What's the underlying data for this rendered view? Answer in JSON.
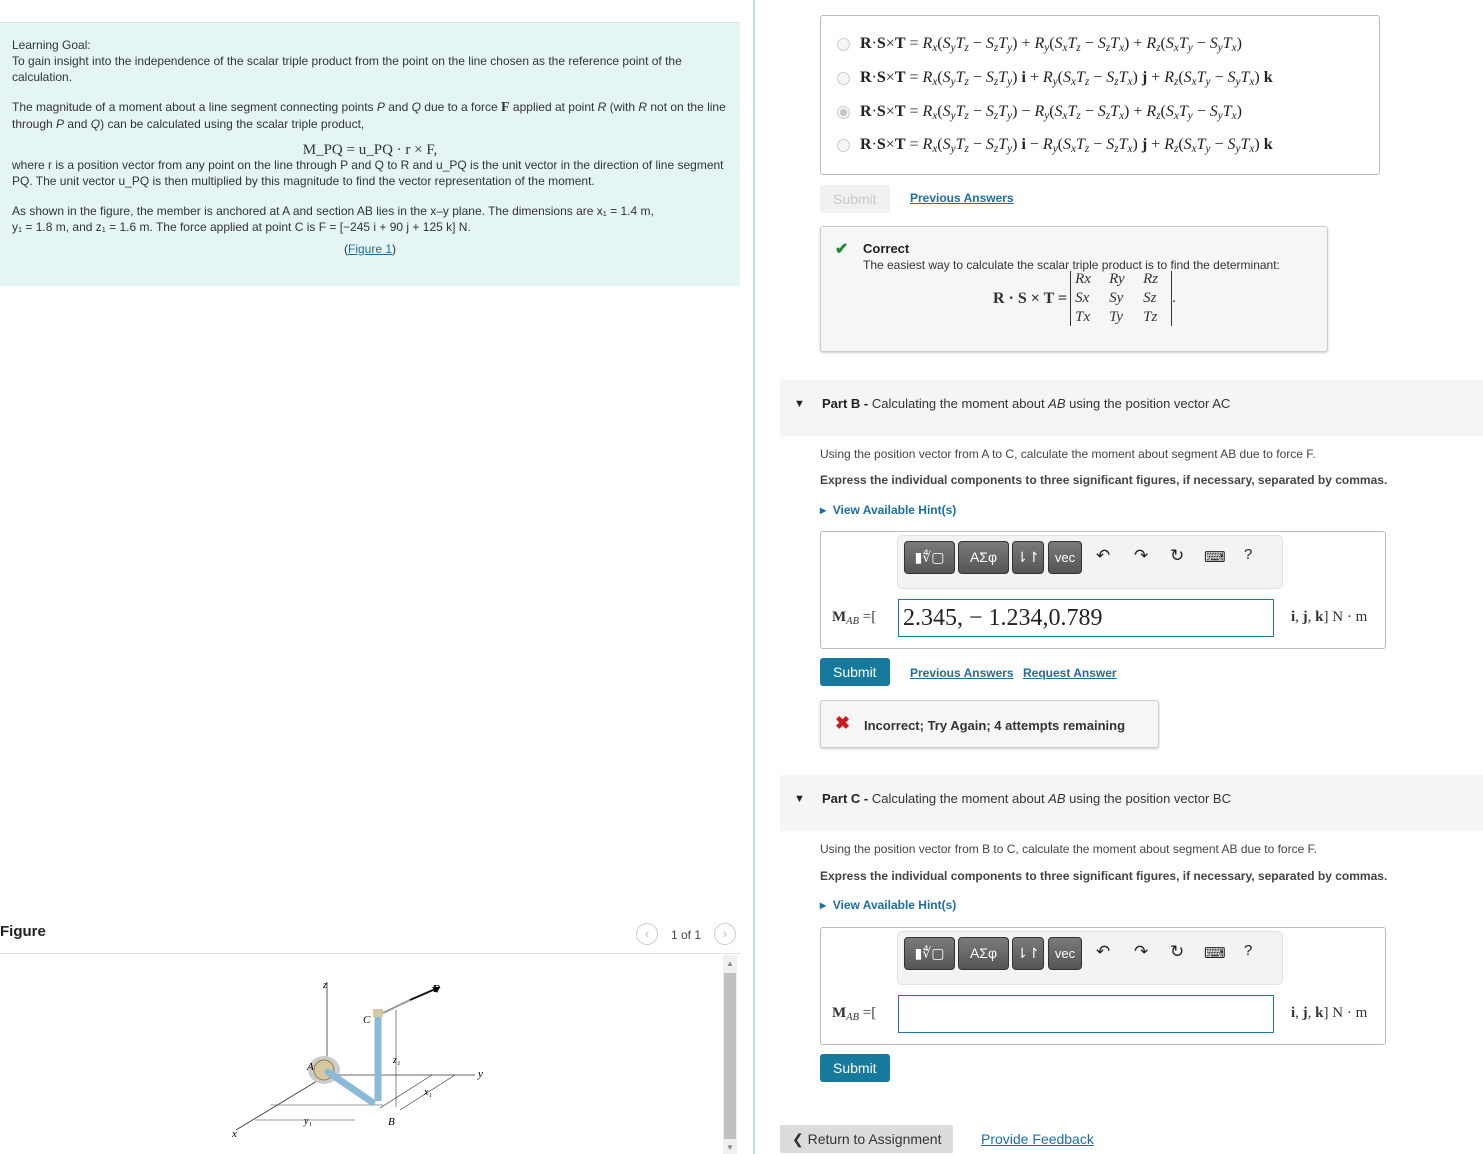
{
  "learning_goal": {
    "heading": "Learning Goal:",
    "goal_text": "To gain insight into the independence of the scalar triple product from the point on the line chosen as the reference point of the calculation.",
    "para1_a": "The magnitude of a moment about a line segment connecting points ",
    "para1_P": "P",
    "para1_b": " and ",
    "para1_Q": "Q",
    "para1_c": " due to a force ",
    "para1_F": "F",
    "para1_d": " applied at point ",
    "para1_R": "R",
    "para1_e": " (with ",
    "para1_R2": "R",
    "para1_f": " not on the line through ",
    "para1_P2": "P",
    "para1_g": " and ",
    "para1_Q2": "Q",
    "para1_h": ") can be calculated using the scalar triple product,",
    "formula": "M_PQ = u_PQ · r × F,",
    "para2": "where r is a position vector from any point on the line through P and Q to R and u_PQ is the unit vector in the direction of line segment PQ. The unit vector u_PQ is then multiplied by this magnitude to find the vector representation of the moment.",
    "para3_line1": "As shown in the figure, the member is anchored at A and section AB lies in the x–y plane. The dimensions are x₁ = 1.4 m,",
    "para3_line2": "y₁ = 1.8 m, and z₁ = 1.6 m. The force applied at point C is F = [−245 i + 90 j + 125 k] N.",
    "figure_link": "Figure 1",
    "dimensions": {
      "x1": "1.4 m",
      "y1": "1.8 m",
      "z1": "1.6 m"
    },
    "force": "F = [−245 i + 90 j + 125 k] N"
  },
  "figure": {
    "title": "Figure",
    "pager": "1 of 1",
    "prev_icon": "chevron-left",
    "next_icon": "chevron-right",
    "labels": {
      "z": "z",
      "y": "y",
      "x": "x",
      "A": "A",
      "B": "B",
      "C": "C",
      "F": "F",
      "z1": "z1",
      "x1": "x1",
      "y1": "y1"
    }
  },
  "part_a": {
    "choices": [
      {
        "text": "R·S×T = Rx(SyTz − SzTy) + Ry(SxTz − SzTx) + Rz(SxTy − SyTx)",
        "selected": false
      },
      {
        "text": "R·S×T = Rx(SyTz − SzTy) i + Ry(SxTz − SzTx) j + Rz(SxTy − SyTx) k",
        "selected": false
      },
      {
        "text": "R·S×T = Rx(SyTz − SzTy) − Ry(SxTz − SzTx) + Rz(SxTy − SyTx)",
        "selected": true
      },
      {
        "text": "R·S×T = Rx(SyTz − SzTy) i − Ry(SxTz − SzTx) j + Rz(SxTy − SyTx) k",
        "selected": false
      }
    ],
    "submit_label": "Submit",
    "previous_answers": "Previous Answers",
    "feedback": {
      "status": "Correct",
      "text": "The easiest way to calculate the scalar triple product is to find the determinant:",
      "lhs": "R · S × T =",
      "matrix": [
        [
          "Rx",
          "Ry",
          "Rz"
        ],
        [
          "Sx",
          "Sy",
          "Sz"
        ],
        [
          "Tx",
          "Ty",
          "Tz"
        ]
      ]
    }
  },
  "part_b": {
    "label": "Part B -",
    "title_a": " Calculating the moment about ",
    "title_ab": "AB",
    "title_b": " using the position vector AC",
    "desc": "Using the position vector from A to C, calculate the moment about segment AB due to force F.",
    "instruction": "Express the individual components to three significant figures, if necessary, separated by commas.",
    "hint": "View Available Hint(s)",
    "toolbar": {
      "templates": "▮∜▢",
      "greek": "ΑΣφ",
      "arrows": "⇂↾",
      "vec": "vec",
      "undo": "undo",
      "redo": "redo",
      "reset": "reset",
      "keyboard": "keyboard",
      "help": "?"
    },
    "answer_label": "M_AB =[",
    "answer_value": "2.345, − 1.234,0.789",
    "answer_unit": "i, j, k] N · m",
    "submit_label": "Submit",
    "previous_answers": "Previous Answers",
    "request_answer": "Request Answer",
    "feedback": {
      "status": "Incorrect; Try Again; 4 attempts remaining"
    }
  },
  "part_c": {
    "label": "Part C -",
    "title_a": " Calculating the moment about ",
    "title_ab": "AB",
    "title_b": " using the position vector BC",
    "desc": "Using the position vector from B to C, calculate the moment about segment AB due to force F.",
    "instruction": "Express the individual components to three significant figures, if necessary, separated by commas.",
    "hint": "View Available Hint(s)",
    "answer_label": "M_AB =[",
    "answer_value": "",
    "answer_unit": "i, j, k] N · m",
    "submit_label": "Submit"
  },
  "footer": {
    "return_label": "Return to Assignment",
    "feedback_link": "Provide Feedback"
  },
  "colors": {
    "accent": "#177a9c",
    "link": "#1a6fa1",
    "goal_bg": "#e5f5f5",
    "correct": "#1f8a3a",
    "incorrect": "#d01818"
  }
}
